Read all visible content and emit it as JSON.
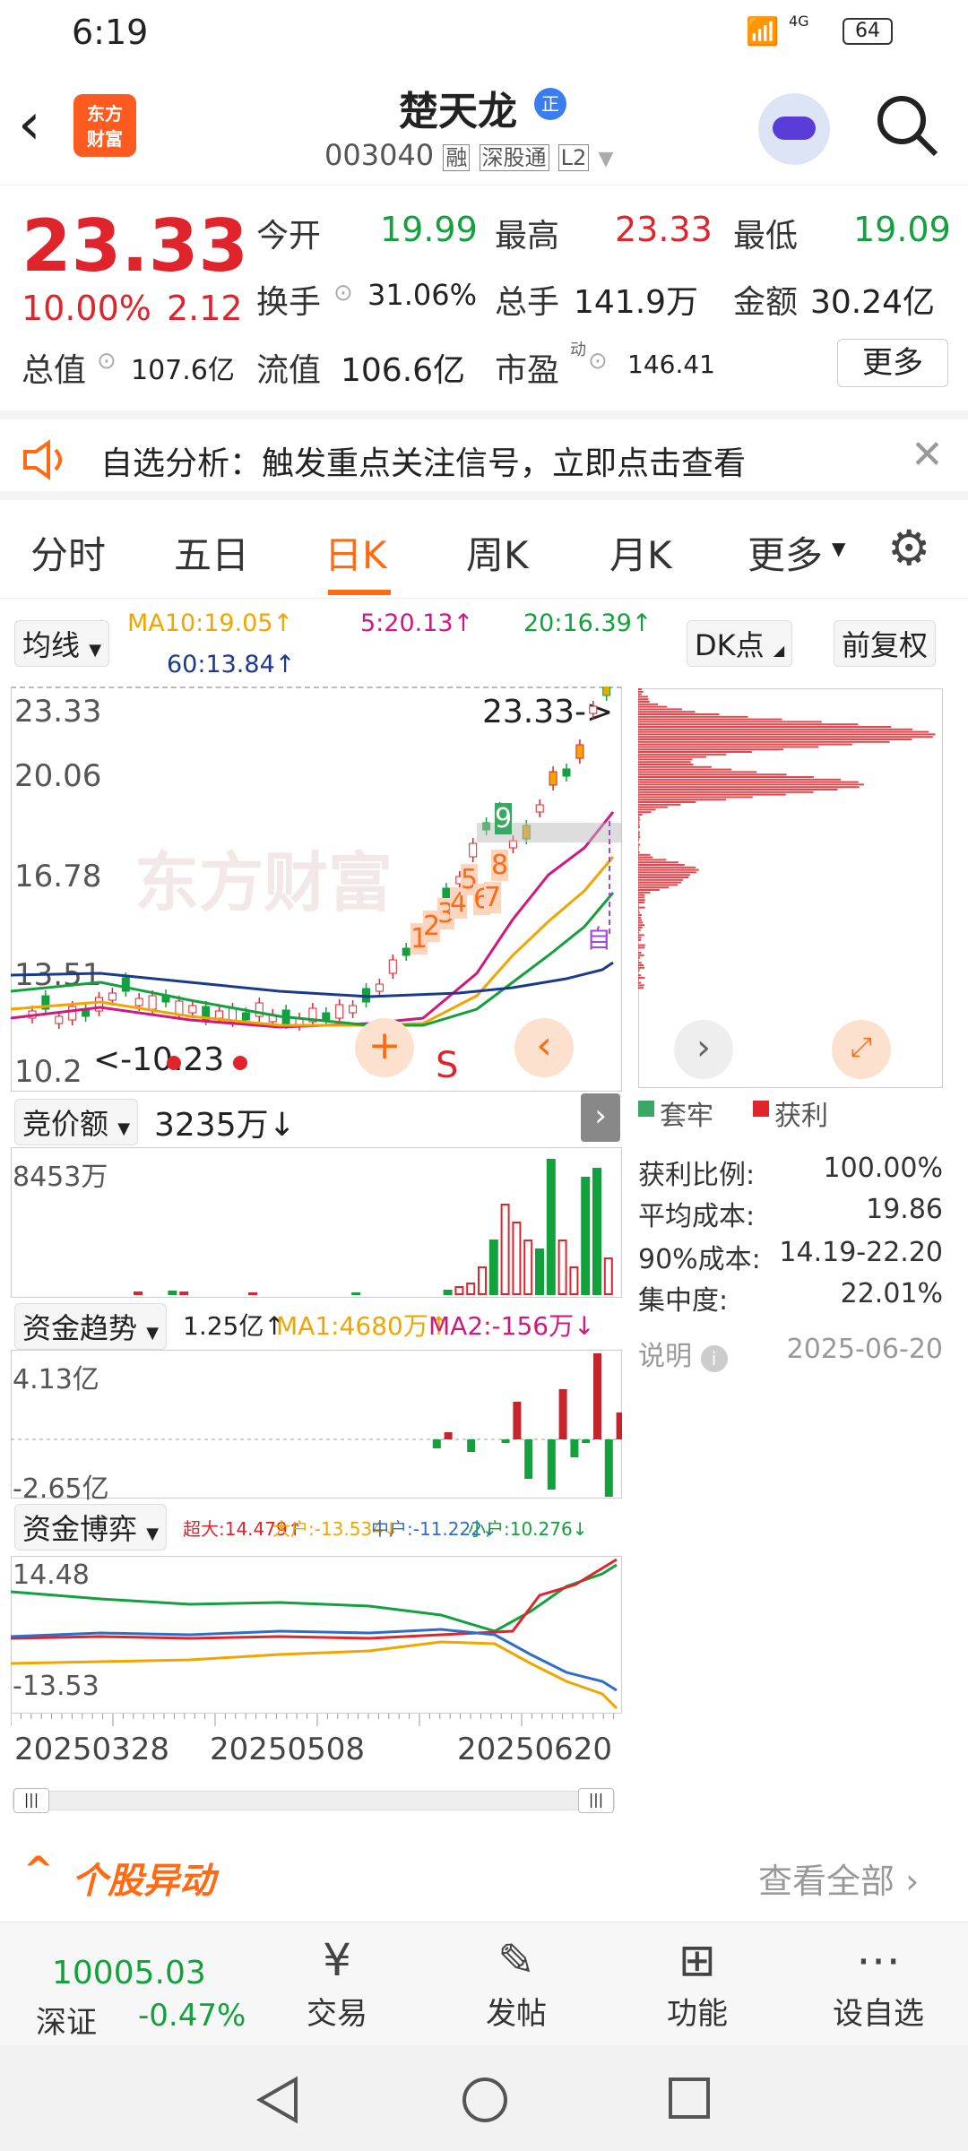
{
  "status": {
    "time": "6:19",
    "battery": "64",
    "network": "4G"
  },
  "header": {
    "title": "楚天龙",
    "title_badge": "正",
    "code": "003040",
    "tag1": "融",
    "tag2": "深股通",
    "tag3": "L2",
    "logo_line1": "东方",
    "logo_line2": "财富"
  },
  "quote": {
    "price": "23.33",
    "pct": "10.00%",
    "chg": "2.12",
    "rows": [
      [
        {
          "l": "今开",
          "v": "19.99",
          "c": "green"
        },
        {
          "l": "最高",
          "v": "23.33",
          "c": "red"
        },
        {
          "l": "最低",
          "v": "19.09",
          "c": "green"
        }
      ],
      [
        {
          "l": "换手",
          "v": "31.06%",
          "c": "dark"
        },
        {
          "l": "总手",
          "v": "141.9万",
          "c": "dark"
        },
        {
          "l": "金额",
          "v": "30.24亿",
          "c": "dark"
        }
      ]
    ],
    "total_value_label": "总值",
    "total_value": "107.6亿",
    "float_label": "流值",
    "float_value": "106.6亿",
    "pe_label": "市盈",
    "pe_sup": "动",
    "pe_value": "146.41",
    "more": "更多"
  },
  "alert": {
    "text": "自选分析：触发重点关注信号，立即点击查看"
  },
  "tabs": [
    "分时",
    "五日",
    "日K",
    "周K",
    "月K",
    "更多"
  ],
  "active_tab": "日K",
  "ma_bar": {
    "selector": "均线",
    "ma10": "MA10:19.05↑",
    "ma5": "5:20.13↑",
    "ma20": "20:16.39↑",
    "ma60": "60:13.84↑",
    "dk": "DK点",
    "adj": "前复权"
  },
  "kline": {
    "labels": [
      "23.33",
      "20.06",
      "16.78",
      "13.51",
      "10.2"
    ],
    "hi_marker": "23.33->",
    "lo_marker": "<-10.23",
    "watermark": "东方财富",
    "s_mark": "S",
    "nums": [
      "1",
      "2",
      "3",
      "4",
      "5",
      "6",
      "7",
      "8",
      "9"
    ],
    "zi": "自"
  },
  "auction": {
    "label": "竞价额",
    "value": "3235万↓",
    "max": "8453万"
  },
  "fund": {
    "label": "资金趋势",
    "value": "1.25亿↑",
    "ma1": "MA1:4680万↑",
    "ma2": "MA2:-156万↓",
    "top": "4.13亿",
    "bottom": "-2.65亿"
  },
  "game": {
    "label": "资金博弈",
    "super": "超大:14.479↑",
    "big": "大户:-13.534↓",
    "mid": "中户:-11.222↓",
    "small": "小户:10.276↓",
    "top": "14.48",
    "bottom": "-13.53"
  },
  "dates": [
    "20250328",
    "20250508",
    "20250620"
  ],
  "chip": {
    "legend1": "套牢",
    "legend2": "获利",
    "rows": [
      {
        "l": "获利比例:",
        "v": "100.00%"
      },
      {
        "l": "平均成本:",
        "v": "19.86"
      },
      {
        "l": "90%成本:",
        "v": "14.19-22.20"
      },
      {
        "l": "集中度:",
        "v": "22.01%"
      }
    ],
    "note": "说明",
    "date": "2025-06-20"
  },
  "abnormal": {
    "title": "个股异动",
    "view_all": "查看全部"
  },
  "bottom": {
    "index_value": "10005.03",
    "index_name": "深证",
    "index_chg": "-0.47%",
    "items": [
      "交易",
      "发帖",
      "功能",
      "设自选"
    ]
  },
  "colors": {
    "red": "#e0242b",
    "green": "#12a13c",
    "orange": "#ff6a13"
  }
}
